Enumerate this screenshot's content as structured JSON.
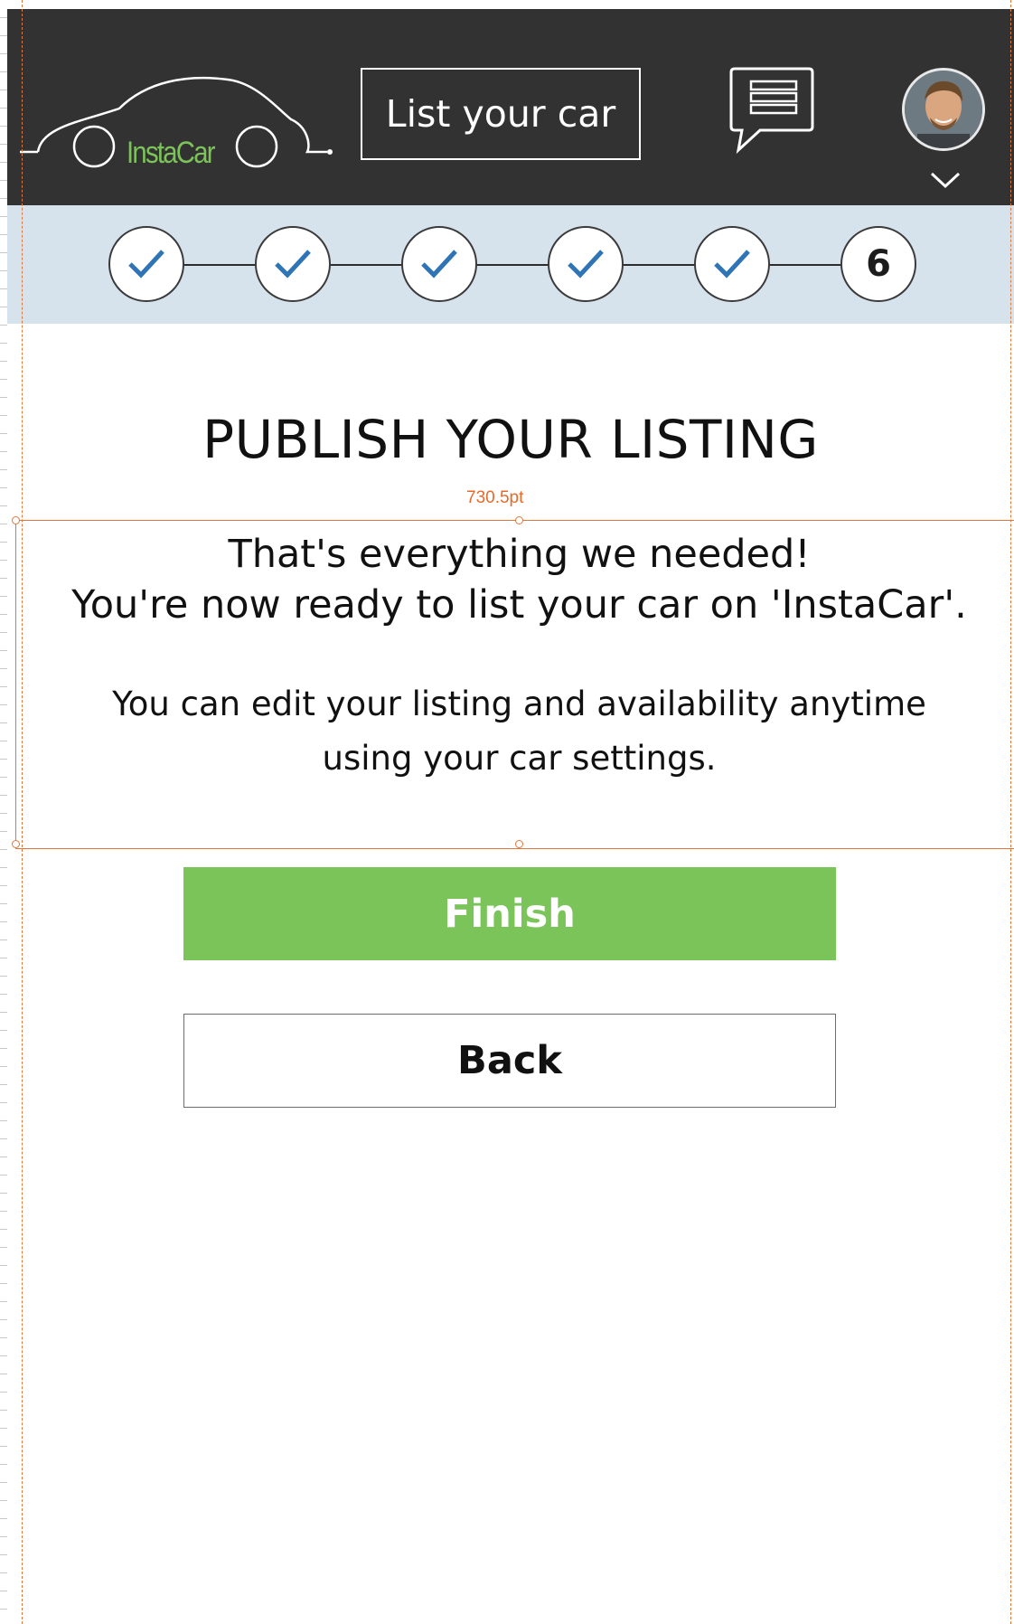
{
  "topbar": {
    "logo_text": "InstaCar",
    "list_car_label": "List your car",
    "chat_icon": "message-bubble-icon",
    "avatar_icon": "user-avatar",
    "caret_icon": "chevron-down-icon"
  },
  "stepper": {
    "steps": [
      {
        "state": "complete",
        "icon": "check-icon"
      },
      {
        "state": "complete",
        "icon": "check-icon"
      },
      {
        "state": "complete",
        "icon": "check-icon"
      },
      {
        "state": "complete",
        "icon": "check-icon"
      },
      {
        "state": "complete",
        "icon": "check-icon"
      },
      {
        "state": "current",
        "label": "6"
      }
    ]
  },
  "page": {
    "title": "PUBLISH YOUR LISTING",
    "measure_label": "730.5pt",
    "message_line1": "That's everything we needed!",
    "message_line2": "You're now ready to list your car on 'InstaCar'.",
    "message_line3": "You can edit your listing and availability anytime",
    "message_line4": "using your car settings."
  },
  "actions": {
    "finish_label": "Finish",
    "back_label": "Back"
  },
  "colors": {
    "topbar_bg": "#323232",
    "stepper_bg": "#d6e3ec",
    "check": "#2f74b5",
    "finish_bg": "#7ac45a",
    "brand_green": "#7cc35a",
    "guide_orange": "#e2773a"
  }
}
